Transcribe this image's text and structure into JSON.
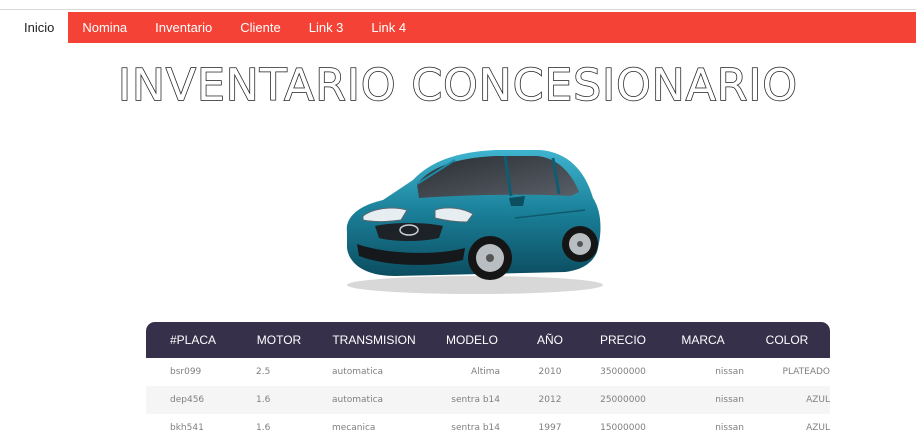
{
  "nav": {
    "items": [
      {
        "label": "Inicio",
        "active": true
      },
      {
        "label": "Nomina",
        "active": false
      },
      {
        "label": "Inventario",
        "active": false
      },
      {
        "label": "Cliente",
        "active": false
      },
      {
        "label": "Link 3",
        "active": false
      },
      {
        "label": "Link 4",
        "active": false
      }
    ],
    "color": "#f44336"
  },
  "page": {
    "title": "INVENTARIO CONCESIONARIO"
  },
  "car_image": {
    "icon": "car-photo",
    "color": "#1e8aa3"
  },
  "table": {
    "header_color": "#36304a",
    "headers": [
      "#PLACA",
      "MOTOR",
      "TRANSMISION",
      "MODELO",
      "AÑO",
      "PRECIO",
      "MARCA",
      "COLOR"
    ],
    "rows": [
      [
        "bsr099",
        "2.5",
        "automatica",
        "Altima",
        "2010",
        "35000000",
        "nissan",
        "PLATEADO"
      ],
      [
        "dep456",
        "1.6",
        "automatica",
        "sentra b14",
        "2012",
        "25000000",
        "nissan",
        "AZUL"
      ],
      [
        "bkh541",
        "1.6",
        "mecanica",
        "sentra b14",
        "1997",
        "15000000",
        "nissan",
        "AZUL"
      ]
    ]
  }
}
